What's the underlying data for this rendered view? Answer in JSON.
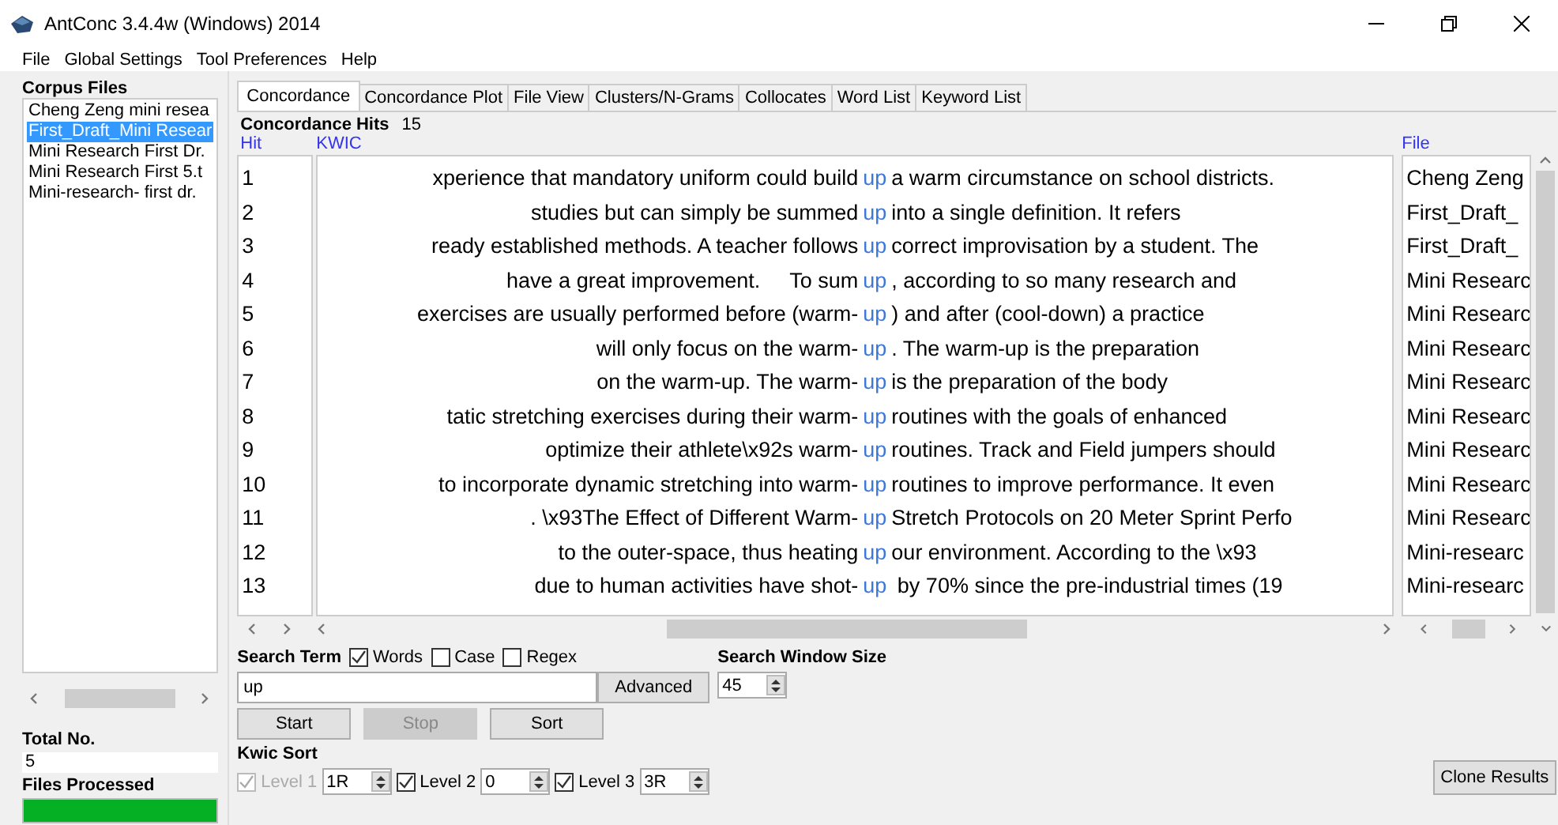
{
  "window": {
    "title": "AntConc 3.4.4w (Windows) 2014"
  },
  "menu": [
    "File",
    "Global Settings",
    "Tool Preferences",
    "Help"
  ],
  "corpus_files": {
    "title": "Corpus Files",
    "items": [
      {
        "label": "Cheng Zeng mini resea",
        "selected": false
      },
      {
        "label": "First_Draft_Mini Resear",
        "selected": true
      },
      {
        "label": "Mini Research First Dr.",
        "selected": false
      },
      {
        "label": "Mini Research First 5.t",
        "selected": false
      },
      {
        "label": "Mini-research- first dr.",
        "selected": false
      }
    ]
  },
  "total_no": {
    "label": "Total No.",
    "value": "5"
  },
  "files_processed": {
    "label": "Files Processed",
    "level": 1
  },
  "tabs": [
    {
      "label": "Concordance",
      "selected": true
    },
    {
      "label": "Concordance Plot",
      "selected": false
    },
    {
      "label": "File View",
      "selected": false
    },
    {
      "label": "Clusters/N-Grams",
      "selected": false
    },
    {
      "label": "Collocates",
      "selected": false
    },
    {
      "label": "Word List",
      "selected": false
    },
    {
      "label": "Keyword List",
      "selected": false
    }
  ],
  "hits": {
    "label": "Concordance Hits",
    "value": "15"
  },
  "columns": {
    "hit": "Hit",
    "kwic": "KWIC",
    "file": "File"
  },
  "rows": [
    {
      "hit": "1",
      "left": "xperience that mandatory uniform could build",
      "key": "up",
      "right": "a warm circumstance on school districts.",
      "file": "Cheng Zeng"
    },
    {
      "hit": "2",
      "left": "studies but can simply be summed",
      "key": "up",
      "right": "into a single definition. It refers",
      "file": "First_Draft_"
    },
    {
      "hit": "3",
      "left": "ready established methods. A teacher follows",
      "key": "up",
      "right": "correct improvisation by a student. The",
      "file": "First_Draft_"
    },
    {
      "hit": "4",
      "left": "have a great improvement.     To sum",
      "key": "up",
      "right": ", according to so many research and",
      "file": "Mini Researc"
    },
    {
      "hit": "5",
      "left": "exercises are usually performed before (warm-",
      "key": "up",
      "right": ") and after (cool-down) a practice",
      "file": "Mini Researc"
    },
    {
      "hit": "6",
      "left": "will only focus on the warm-",
      "key": "up",
      "right": ". The warm-up is the preparation",
      "file": "Mini Researc"
    },
    {
      "hit": "7",
      "left": "on the warm-up. The warm-",
      "key": "up",
      "right": "is the preparation of the body",
      "file": "Mini Researc"
    },
    {
      "hit": "8",
      "left": "tatic stretching exercises during their warm-",
      "key": "up",
      "right": "routines with the goals of enhanced",
      "file": "Mini Researc"
    },
    {
      "hit": "9",
      "left": "optimize their athlete\\x92s warm-",
      "key": "up",
      "right": "routines. Track and Field jumpers should",
      "file": "Mini Researc"
    },
    {
      "hit": "10",
      "left": "to incorporate dynamic stretching into warm-",
      "key": "up",
      "right": "routines to improve performance. It even",
      "file": "Mini Researc"
    },
    {
      "hit": "11",
      "left": ". \\x93The Effect of Different Warm-",
      "key": "up",
      "right": "Stretch Protocols on 20 Meter Sprint Perfo",
      "file": "Mini Researc"
    },
    {
      "hit": "12",
      "left": "to the outer-space, thus heating",
      "key": "up",
      "right": "our environment. According to the \\x93",
      "file": "Mini-researc"
    },
    {
      "hit": "13",
      "left": "due to human activities have shot-",
      "key": "up",
      "right": " by 70% since the pre-industrial times (19",
      "file": "Mini-researc"
    }
  ],
  "search_term": {
    "label": "Search Term",
    "value": "up",
    "options": [
      {
        "label": "Words",
        "checked": true
      },
      {
        "label": "Case",
        "checked": false
      },
      {
        "label": "Regex",
        "checked": false
      }
    ],
    "advanced": "Advanced"
  },
  "search_window": {
    "label": "Search Window Size",
    "value": "45"
  },
  "buttons": [
    {
      "label": "Start",
      "disabled": false
    },
    {
      "label": "Stop",
      "disabled": true
    },
    {
      "label": "Sort",
      "disabled": false
    }
  ],
  "kwic_sort": {
    "label": "Kwic Sort",
    "levels": [
      {
        "label": "Level 1",
        "checked": true,
        "disabled": true,
        "value": "1R"
      },
      {
        "label": "Level 2",
        "checked": true,
        "disabled": false,
        "value": "0"
      },
      {
        "label": "Level 3",
        "checked": true,
        "disabled": false,
        "value": "3R"
      }
    ]
  },
  "clone": "Clone Results"
}
